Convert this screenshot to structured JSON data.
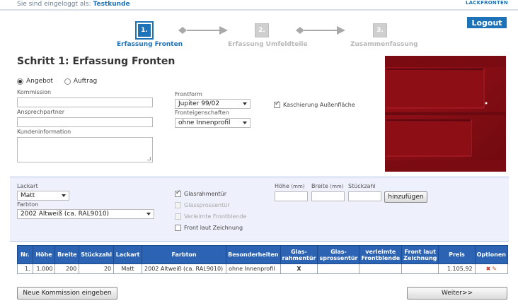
{
  "header": {
    "login_prefix": "Sie sind eingeloggt als:",
    "login_user": "Testkunde",
    "brand": "LACKFRONTEN"
  },
  "steps": [
    {
      "number": "1.",
      "label": "Erfassung Fronten",
      "active": true
    },
    {
      "number": "2.",
      "label": "Erfassung Umfeldteile",
      "active": false
    },
    {
      "number": "3.",
      "label": "Zusammenfassung",
      "active": false
    }
  ],
  "logout_label": "Logout",
  "page_title": "Schritt 1: Erfassung Fronten",
  "order_type": {
    "options": [
      "Angebot",
      "Auftrag"
    ],
    "selected": "Angebot"
  },
  "form": {
    "kommission_label": "Kommission",
    "kommission_value": "",
    "ansprechpartner_label": "Ansprechpartner",
    "ansprechpartner_value": "",
    "kundeninformation_label": "Kundeninformation",
    "kundeninformation_value": "",
    "frontform_label": "Frontform",
    "frontform_value": "Jupiter 99/02",
    "fronteigenschaften_label": "Fronteigenschaften",
    "fronteigenschaften_value": "ohne Innenprofil",
    "kaschierung_label": "Kaschierung Außenfläche",
    "kaschierung_checked": true
  },
  "config": {
    "lackart_label": "Lackart",
    "lackart_value": "Matt",
    "farbton_label": "Farbton",
    "farbton_value": "2002 Altweiß (ca. RAL9010)",
    "glasrahmentuer_label": "Glasrahmentür",
    "glasrahmentuer_checked": true,
    "glassprossentuer_label": "Glassprossentür",
    "verleimte_label": "Verleimte Frontblende",
    "front_zeichnung_label": "Front laut Zeichnung",
    "hoehe_label": "Höhe",
    "breite_label": "Breite",
    "unit": "(mm)",
    "stueckzahl_label": "Stückzahl",
    "add_button": "hinzufügen"
  },
  "table": {
    "headers": [
      "Nr.",
      "Höhe",
      "Breite",
      "Stückzahl",
      "Lackart",
      "Farbton",
      "Besonderheiten",
      "Glas-rahmentür",
      "Glas-sprossentür",
      "verleimte Frontblende",
      "Front laut Zeichnung",
      "Preis",
      "Optionen"
    ],
    "rows": [
      [
        "1.",
        "1.000",
        "200",
        "20",
        "Matt",
        "2002 Altweiß (ca. RAL9010)",
        "ohne Innenprofil",
        "X",
        "",
        "",
        "",
        "1.105,92",
        ""
      ]
    ]
  },
  "footer": {
    "new_commission": "Neue Kommission eingeben",
    "next": "Weiter>>"
  },
  "colors": {
    "accent": "#1e73b8",
    "preview_red": "#8b0d14",
    "panel_bg": "#eef0fb"
  }
}
